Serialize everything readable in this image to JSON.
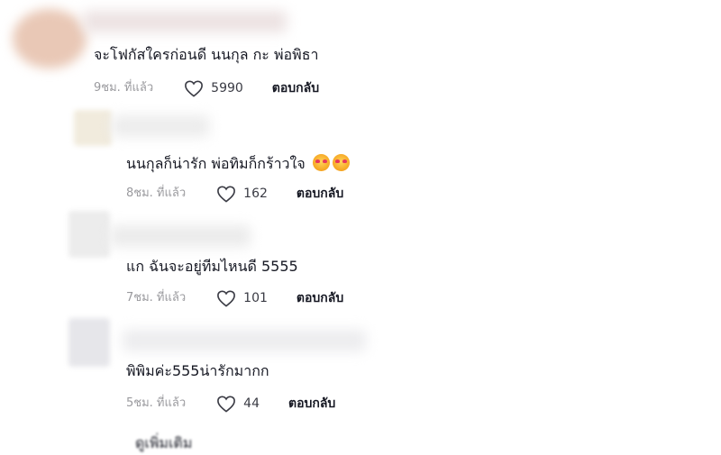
{
  "comments": [
    {
      "text": "จะโฟกัสใครก่อนดี นนกุล กะ พ่อพิธา",
      "time": "9ชม. ที่แล้ว",
      "likes": "5990",
      "reply": "ตอบกลับ",
      "avatar_color": "#e9c8b6",
      "name_color": "#ece2e2"
    },
    {
      "text": "นนกุลก็น่ารัก พ่อทิมก็กร้าวใจ",
      "emoji": [
        "smiling-face-with-hearts",
        "smiling-face-with-hearts"
      ],
      "time": "8ชม. ที่แล้ว",
      "likes": "162",
      "reply": "ตอบกลับ",
      "avatar_color": "#f1ebdd",
      "name_color": "#ececec"
    },
    {
      "text": "แก ฉันจะอยู่ทีมไหนดี 5555",
      "time": "7ชม. ที่แล้ว",
      "likes": "101",
      "reply": "ตอบกลับ",
      "avatar_color": "#ececec",
      "name_color": "#ebebeb"
    },
    {
      "text": "พิพิมค่ะ555น่ารักมากก",
      "time": "5ชม. ที่แล้ว",
      "likes": "44",
      "reply": "ตอบกลับ",
      "avatar_color": "#e6e6ea",
      "name_color": "#ececee"
    }
  ],
  "partial_next": "ดูเพิ่มเติม"
}
